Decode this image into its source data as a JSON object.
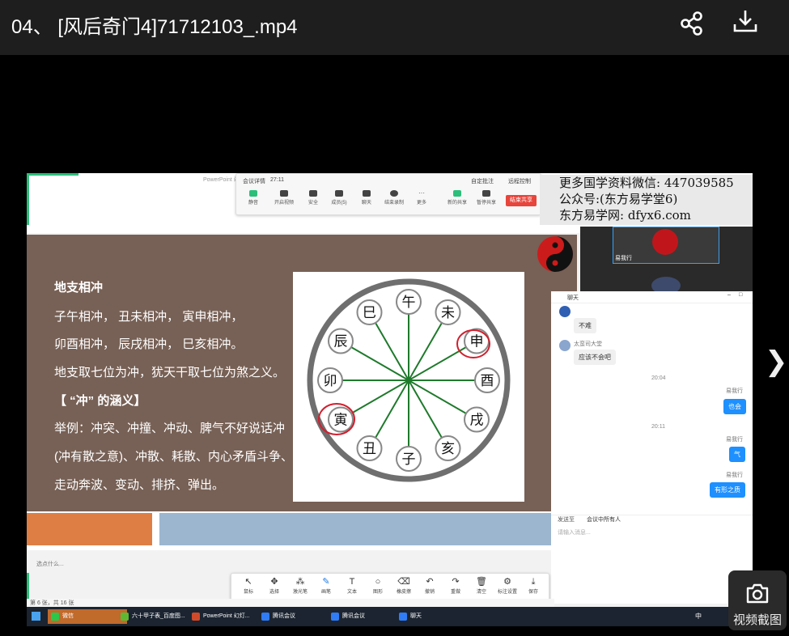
{
  "header": {
    "title": "04、 [风后奇门4]71712103_.mp4"
  },
  "meeting_bar": {
    "left_label": "会议详情",
    "timer": "27:11",
    "right_labels": [
      "自定批注",
      "远程控制"
    ],
    "buttons": [
      "静音",
      "开启视频",
      "安全",
      "成员(5)",
      "聊天",
      "结束录制",
      "更多",
      "新的共享",
      "暂停共享"
    ],
    "end_share": "结束共享"
  },
  "ppt_window_title": "PowerPoint 幻",
  "slide": {
    "lines": [
      "地支相冲",
      "子午相冲， 丑未相冲， 寅申相冲，",
      "卯酉相冲， 辰戌相冲， 巳亥相冲。",
      "地支取七位为冲，犹天干取七位为煞之义。",
      "【 “冲” 的涵义】",
      "举例：冲突、冲撞、冲动、脾气不好说话冲",
      "(冲有散之意)、冲散、耗散、内心矛盾斗争、",
      "走动奔波、变动、排挤、弹出。"
    ],
    "wheel_branches": [
      "午",
      "未",
      "申",
      "酉",
      "戌",
      "亥",
      "子",
      "丑",
      "寅",
      "卯",
      "辰",
      "巳"
    ]
  },
  "watermark": {
    "line1": "更多国学资料微信: 447039585",
    "line2": "公众号:(东方易学堂6)",
    "line3": "东方易学网: dfyx6.com"
  },
  "camera": {
    "name": "易我行"
  },
  "chat": {
    "title": "聊天",
    "messages": [
      {
        "sender": "",
        "text": "不难"
      },
      {
        "sender": "太蛮司大堂",
        "text": "应该不会吧"
      },
      {
        "time": "20:04"
      },
      {
        "sender": "易我行",
        "text": "也会",
        "me": true
      },
      {
        "time": "20:11"
      },
      {
        "sender": "易我行",
        "text": "气",
        "me": true
      },
      {
        "sender": "易我行",
        "text": "有形之质",
        "me": true
      }
    ],
    "send_to_label": "发送至",
    "send_to_value": "会议中所有人",
    "input_placeholder": "请输入消息..."
  },
  "draw_toolbar": {
    "tools": [
      {
        "label": "鼠标",
        "icon": "↖"
      },
      {
        "label": "选择",
        "icon": "✥"
      },
      {
        "label": "激光笔",
        "icon": "⁂"
      },
      {
        "label": "画笔",
        "icon": "✎",
        "active": true
      },
      {
        "label": "文本",
        "icon": "T"
      },
      {
        "label": "图形",
        "icon": "○"
      },
      {
        "label": "橡皮擦",
        "icon": "⌫"
      },
      {
        "label": "撤销",
        "icon": "↶"
      },
      {
        "label": "重做",
        "icon": "↷"
      },
      {
        "label": "清空",
        "icon": "🗑"
      },
      {
        "label": "标注设置",
        "icon": "⚙"
      },
      {
        "label": "保存",
        "icon": "⤓"
      }
    ]
  },
  "status": {
    "slide_count": "第 6 张，共 16 张",
    "hint": "选点什么..."
  },
  "taskbar": {
    "items": [
      {
        "label": "微信",
        "color": "#2bc84a"
      },
      {
        "label": "六十甲子表_百度图...",
        "color": "#5fb832"
      },
      {
        "label": "PowerPoint 幻灯...",
        "color": "#d04a2a"
      },
      {
        "label": "腾讯会议",
        "color": "#2f7cf6"
      },
      {
        "label": "腾讯会议",
        "color": "#2f7cf6"
      },
      {
        "label": "聊天",
        "color": "#2f7cf6"
      }
    ],
    "ime": "中"
  },
  "screenshot_button": {
    "label": "视频截图"
  },
  "colors": {
    "slide_bg": "#776055",
    "accent_green": "#2bbf7a",
    "end_share_red": "#e8453c",
    "chat_bubble_blue": "#1e90ff"
  }
}
